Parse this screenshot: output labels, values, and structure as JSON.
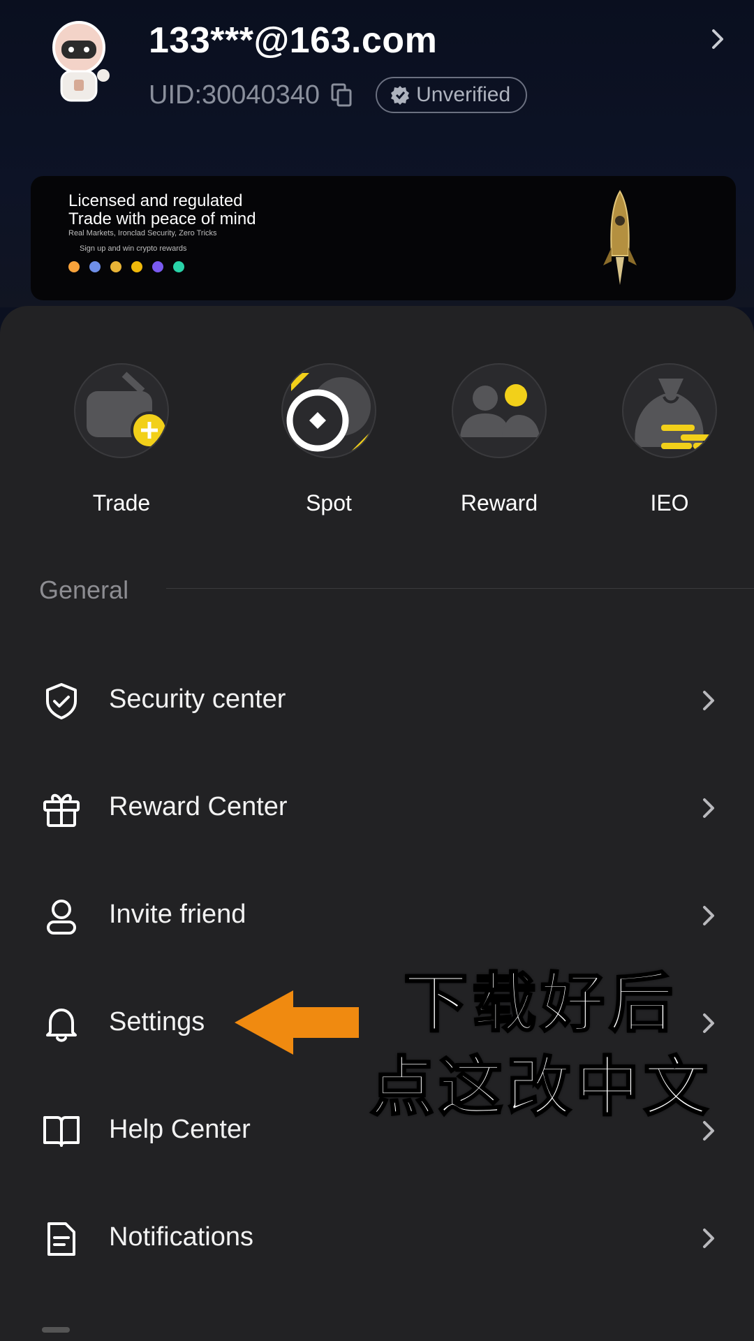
{
  "profile": {
    "email": "133***@163.com",
    "uid": "UID:30040340",
    "verification_badge": "Unverified"
  },
  "banner": {
    "line1": "Licensed and regulated",
    "line2": "Trade with peace of mind",
    "line3": "Real Markets, Ironclad Security, Zero Tricks",
    "line4": "Sign up and win crypto rewards"
  },
  "quick_actions": [
    {
      "label": "Trade",
      "icon": "wallet-add-icon"
    },
    {
      "label": "Spot",
      "icon": "spot-coin-icon"
    },
    {
      "label": "Reward",
      "icon": "users-reward-icon"
    },
    {
      "label": "IEO",
      "icon": "money-bag-icon"
    }
  ],
  "general": {
    "title": "General",
    "items": [
      {
        "label": "Security center",
        "icon": "shield-check-icon"
      },
      {
        "label": "Reward Center",
        "icon": "gift-icon"
      },
      {
        "label": "Invite friend",
        "icon": "person-icon"
      },
      {
        "label": "Settings",
        "icon": "bell-icon"
      },
      {
        "label": "Help Center",
        "icon": "book-icon"
      },
      {
        "label": "Notifications",
        "icon": "document-icon"
      }
    ]
  },
  "annotation": {
    "line1": "下载好后",
    "line2": "点这改中文"
  },
  "colors": {
    "accent_yellow": "#f2d01a",
    "arrow_orange": "#f08a10",
    "panel_bg": "#222224",
    "header_bg": "#0b1020"
  }
}
